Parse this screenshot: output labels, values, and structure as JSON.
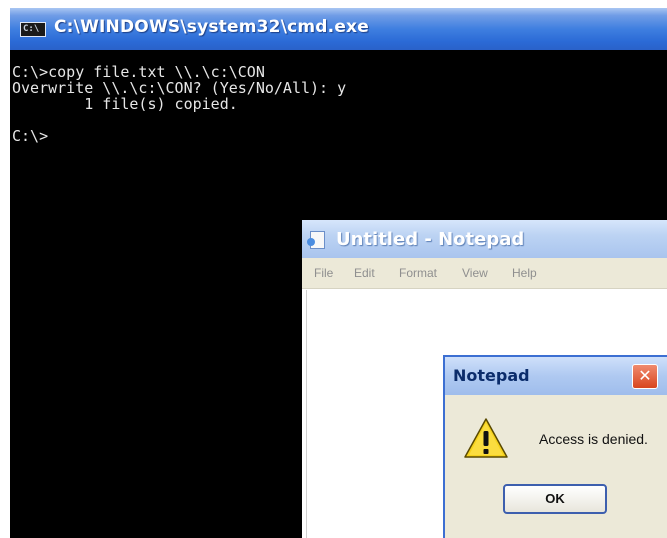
{
  "cmd": {
    "title": "C:\\WINDOWS\\system32\\cmd.exe",
    "icon": "console-icon",
    "lines": [
      "C:\\>copy file.txt \\\\.\\c:\\CON",
      "Overwrite \\\\.\\c:\\CON? (Yes/No/All): y",
      "        1 file(s) copied.",
      "",
      "C:\\>"
    ]
  },
  "notepad": {
    "title": "Untitled - Notepad",
    "icon": "notepad-icon",
    "menu": [
      "File",
      "Edit",
      "Format",
      "View",
      "Help"
    ]
  },
  "dialog": {
    "title": "Notepad",
    "close_label": "✕",
    "message": "Access is denied.",
    "ok_label": "OK",
    "icon": "warning-icon"
  },
  "colors": {
    "console_bg": "#000000",
    "console_text": "#e6e6e6",
    "titlebar_blue": "#2b6ad6",
    "close_red": "#d8451f",
    "dialog_bg": "#ece9d8"
  }
}
